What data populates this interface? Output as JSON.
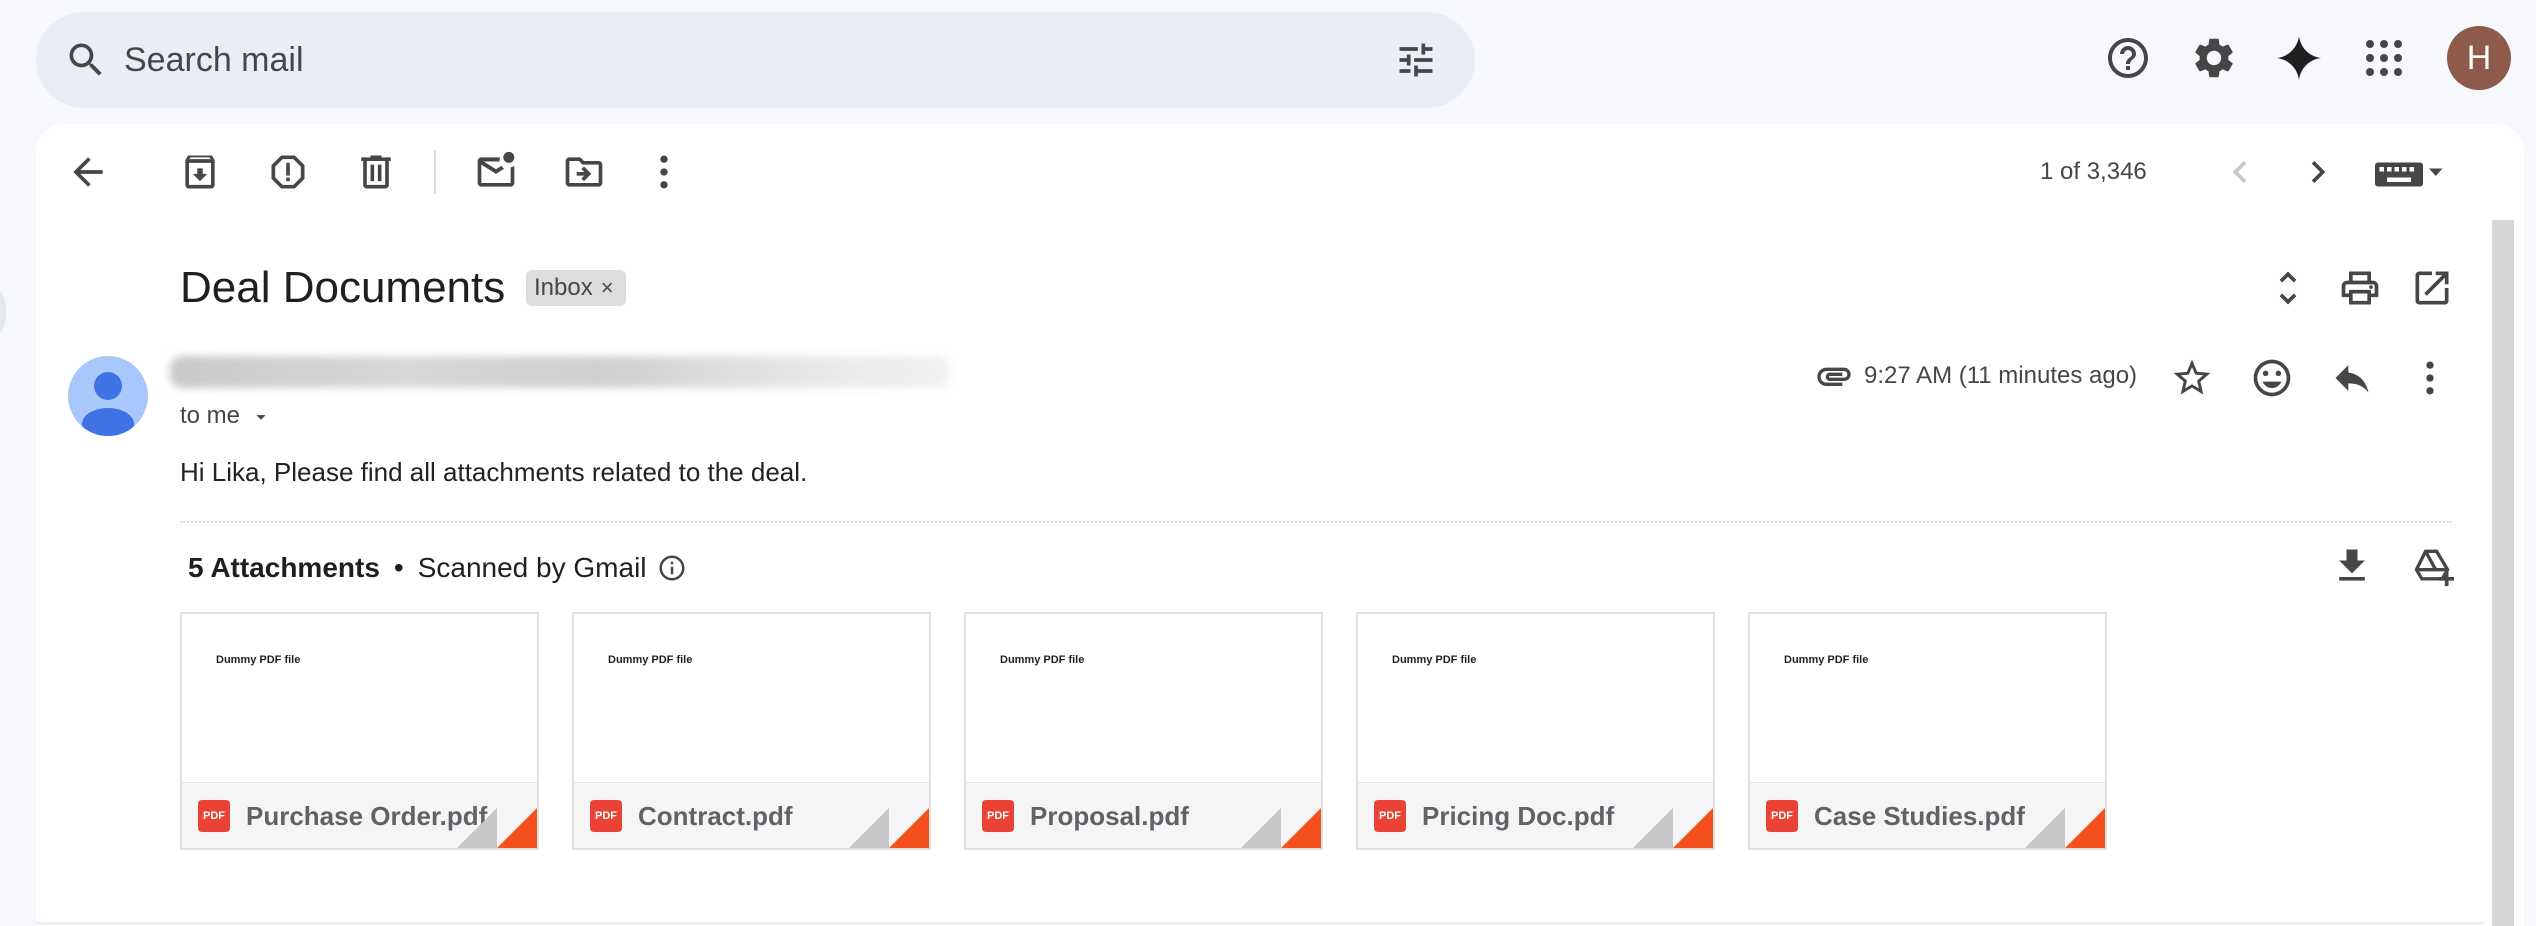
{
  "search": {
    "placeholder": "Search mail",
    "icon": "search-icon",
    "options_icon": "tune-icon"
  },
  "header": {
    "icons": [
      "help-icon",
      "settings-icon",
      "gemini-icon",
      "apps-icon"
    ],
    "account_initial": "H"
  },
  "toolbar": {
    "actions": [
      "back-icon",
      "archive-icon",
      "report-spam-icon",
      "delete-icon",
      "mark-unread-icon",
      "move-to-icon",
      "more-icon"
    ],
    "pager_text": "1 of 3,346",
    "input_tools": "keyboard-icon"
  },
  "email": {
    "subject": "Deal Documents",
    "label_chip": "Inbox",
    "chip_close": "×",
    "recipient": "to me",
    "time": "9:27 AM (11 minutes ago)",
    "body": "Hi Lika, Please find all attachments related to the deal."
  },
  "attachments": {
    "count_label": "5 Attachments",
    "separator": "•",
    "scanned_label": "Scanned by Gmail",
    "preview_text": "Dummy PDF file",
    "badge": "PDF",
    "files": [
      {
        "name": "Purchase Order.pdf"
      },
      {
        "name": "Contract.pdf"
      },
      {
        "name": "Proposal.pdf"
      },
      {
        "name": "Pricing Doc.pdf"
      },
      {
        "name": "Case Studies.pdf"
      }
    ]
  },
  "colors": {
    "page_bg": "#f6f8fc",
    "search_bg": "#e9eef6",
    "avatar_bg": "#8d5a4b",
    "pdf_red": "#ea4335",
    "fold_orange": "#f4511e"
  }
}
